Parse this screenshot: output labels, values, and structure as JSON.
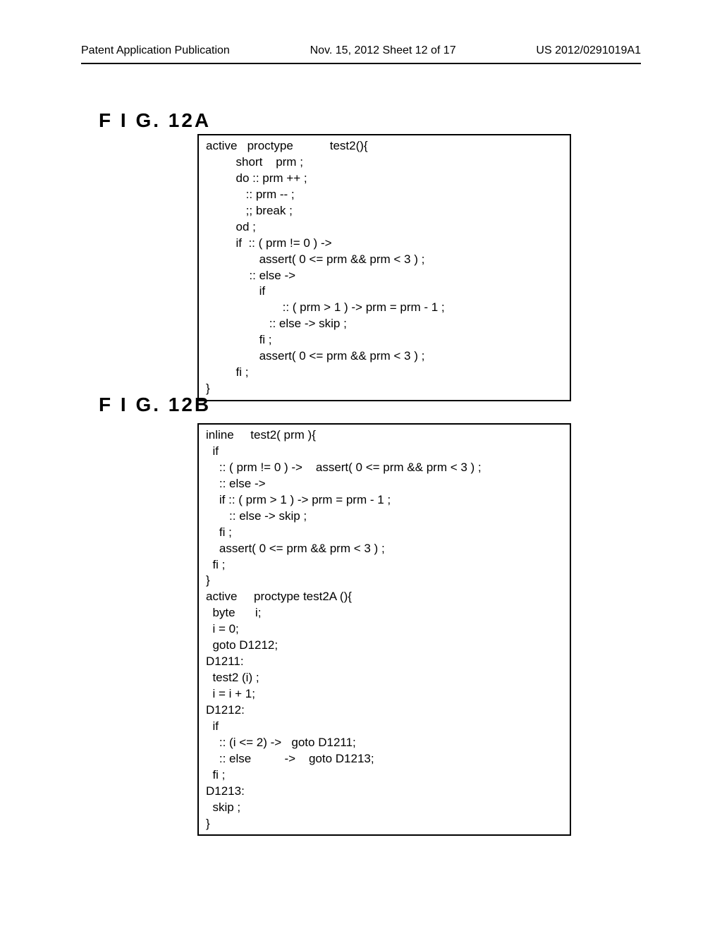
{
  "header": {
    "left": "Patent Application Publication",
    "center": "Nov. 15, 2012  Sheet 12 of 17",
    "right": "US 2012/0291019A1"
  },
  "figures": {
    "a": {
      "label": "F I G.   12A",
      "code": "active   proctype           test2(){\n         short    prm ;\n         do :: prm ++ ;\n            :: prm -- ;\n            ;; break ;\n         od ;\n         if  :: ( prm != 0 ) ->\n                assert( 0 <= prm && prm < 3 ) ;\n             :: else ->\n                if\n                       :: ( prm > 1 ) -> prm = prm - 1 ;\n                   :: else -> skip ;\n                fi ;\n                assert( 0 <= prm && prm < 3 ) ;\n         fi ;\n}"
    },
    "b": {
      "label": "F I G.   12B",
      "code": "inline     test2( prm ){\n  if\n    :: ( prm != 0 ) ->    assert( 0 <= prm && prm < 3 ) ;\n    :: else ->\n    if :: ( prm > 1 ) -> prm = prm - 1 ;\n       :: else -> skip ;\n    fi ;\n    assert( 0 <= prm && prm < 3 ) ;\n  fi ;\n}\nactive     proctype test2A (){\n  byte      i;\n  i = 0;\n  goto D1212;\nD1211:\n  test2 (i) ;\n  i = i + 1;\nD1212:\n  if\n    :: (i <= 2) ->   goto D1211;\n    :: else          ->    goto D1213;\n  fi ;\nD1213:\n  skip ;\n}"
    }
  }
}
